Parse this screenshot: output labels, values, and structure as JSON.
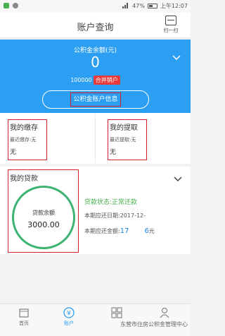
{
  "status_bar": {
    "battery": "47%",
    "time": "上午12:07"
  },
  "header": {
    "title": "账户查询",
    "scan_label": "扫一扫"
  },
  "fund": {
    "balance_label": "公积金余额(元)",
    "balance_value": "0",
    "account_number": "100000",
    "merge_badge": "合并销户",
    "info_button": "公积金账户信息"
  },
  "deposit": {
    "title": "我的缴存",
    "recent_label": "最近缴存:无",
    "value": "无"
  },
  "withdraw": {
    "title": "我的提取",
    "recent_label": "最近提取:无",
    "value": "无"
  },
  "loan": {
    "title": "我的贷款",
    "balance_label": "贷款余额",
    "balance_value": "3000.00",
    "status": "贷款状态:正常还款",
    "due_date_label": "本期应还日期:",
    "due_date_value": "2017-12-",
    "due_amount_label": "本期应还金额:",
    "due_amount_part1": "17",
    "due_amount_part2": "6",
    "due_amount_unit": "元"
  },
  "tabs": [
    {
      "label": "首页",
      "icon": "home-icon"
    },
    {
      "label": "账户",
      "icon": "yuan-icon"
    },
    {
      "label": "",
      "icon": "grid-icon"
    },
    {
      "label": "",
      "icon": "user-icon"
    }
  ],
  "active_tab": 1,
  "watermark": "东营市住房公积金管理中心",
  "colors": {
    "accent": "#2c9ff2",
    "highlight_box": "#d1202a",
    "badge": "#e83a3a",
    "loan_ring": "#3cb371"
  }
}
